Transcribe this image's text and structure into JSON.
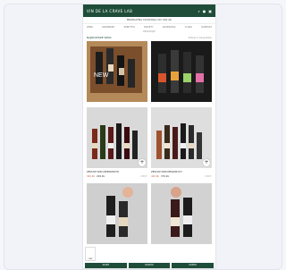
{
  "header": {
    "brand": "VIN DE LA CRAVE LAB",
    "icons": [
      "search-icon",
      "user-icon",
      "cart-icon"
    ],
    "announcement": "BEZPŁATNA DOSTAWA OD 300 ZŁ"
  },
  "nav": {
    "items": [
      "WINA",
      "SZAMPANY",
      "SPIRYTUS",
      "PAKIETY",
      "AKCESORIA",
      "O NAS",
      "KONTAKT"
    ],
    "sub": "PROMOCJE"
  },
  "section": {
    "title": "NAJNOWSZE WINA",
    "link": "Zobacz wszystkie"
  },
  "products": [
    {
      "title": "",
      "price_old": "",
      "price": "",
      "meta": "",
      "thumb": "crate",
      "overlay": "NEW"
    },
    {
      "title": "",
      "price_old": "",
      "price": "",
      "meta": "",
      "thumb": "dark-bottles",
      "overlay": ""
    },
    {
      "title": "ZESTAW WIN CZERWONYCH",
      "price_old": "349 ZŁ",
      "price": "299 ZŁ",
      "meta": "6 BUT.",
      "thumb": "row-bottles",
      "overlay": ""
    },
    {
      "title": "ZESTAW WIN MIESZANYCH",
      "price_old": "429 ZŁ",
      "price": "379 ZŁ",
      "meta": "6 BUT.",
      "thumb": "row-bottles-2",
      "overlay": ""
    },
    {
      "title": "",
      "price_old": "",
      "price": "",
      "meta": "",
      "thumb": "hand-bottle",
      "overlay": ""
    },
    {
      "title": "",
      "price_old": "",
      "price": "",
      "meta": "",
      "thumb": "hand-bottle-2",
      "overlay": ""
    }
  ],
  "add_label": "+",
  "bottom_buttons": [
    "SKLEP",
    "KOSZYK",
    "KONTO"
  ],
  "chat_badge": "CZAT",
  "colors": {
    "brand_green": "#1f4d3a",
    "price": "#c4604c"
  }
}
